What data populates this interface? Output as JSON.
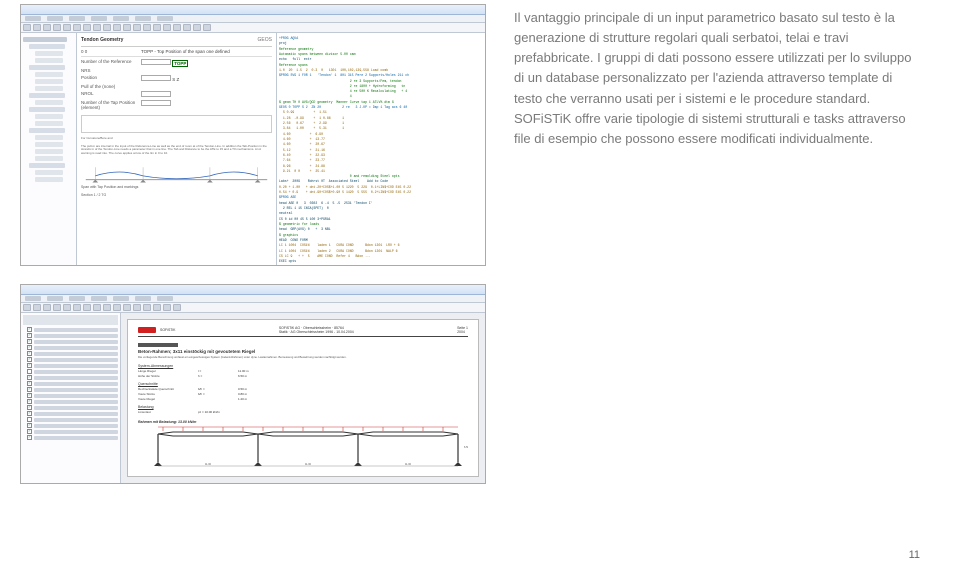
{
  "page_number": "11",
  "description": {
    "paragraph": "Il vantaggio principale di un input parametrico basato sul testo è la generazione di strutture regolari quali serbatoi, telai e travi prefabbricate. I gruppi di dati possono essere utilizzati per lo sviluppo di un database personalizzato per l'azienda attraverso template di testo che verranno usati per i sistemi e le procedure standard. SOFiSTiK offre varie tipologie di sistemi strutturali e tasks attraverso file di esempio che possono essere modificati individualmente."
  },
  "screenshot_a": {
    "panel_title": "Tendon Geometry",
    "panel_code": "GEOS",
    "field_code_label": "0 0",
    "field_code_desc": "TOPP - Top Position of the span one defined",
    "subfield1": "Number of the Reference",
    "subfield2": "NRS",
    "position_label": "Position",
    "pull_label": "Pull of the (none)",
    "roll_label": "NROL",
    "tap_label": "Number of the Tap Position (element)",
    "footer_left": "For Curvature/Bore and",
    "option_s": "S",
    "option_z": "Z",
    "option_topp": "TOPP",
    "beam_label": "Span with Tap Position and markings",
    "section_label": "Section 1 / 2 TG",
    "code": {
      "l1": "+PROG AQUA",
      "l2": "proj",
      "l3": "Reference geometry",
      "l4": "Automatic spans between divisor 5.00 cam",
      "l5": "echo   full  extr",
      "l6": "Reference spans",
      "l7": "1.0  20  1.5  2  0.3  0   1301  100,102,139,558 Load comb",
      "l8": "",
      "l9": "$PROG SVG 1 FOR 1   'Tendon' 1  801 315 Pere 2 Supports/Holes 211 ch",
      "l10": "                                     2 re 3 Supports/Fem, tendon",
      "l11": "                                     2 re 1800 + Hydroforming   tn",
      "l12": "                                     4 re 500 K Recalculating   + 4 ",
      "l13": "                                     4",
      "l14": "",
      "l15": "$ geom TH 0 AVG/QCD geometry  Manner Curve tap 1 ATLV% dtm G",
      "l16": "GEOS 0 TOPP S 2  ZN 20           2 re   3 J.OP = Dap 1 Tag acs 6 40",
      "l17": "  S 0.99          +  1.51",
      "l18": "  1.28  -0.99     +  1 0.86      1",
      "l19": "  2.56   0.67     +  2.99        1",
      "l20": "  3.84   1.00     +  5.31        1",
      "l21": "  4.60          +  6.90",
      "l22": "  4.60          +  13.77",
      "l23": "  4.60          +  20.67",
      "l24": "  5.12          +  21.16",
      "l25": "  6.40          +  22.93",
      "l26": "  7.64          +  23.77",
      "l27": "  8.96          +  24.88",
      "l28": "  9.21  0 0     +  25.41",
      "l29": "                                     0 and remolding Steel opts",
      "l30": "Labs+  2009    Rohrst 0T  Associated Steel    Add to Code",
      "l31": "0.20 + 1.00   + dnt.20+COS$+1.00 5 1220  5 229  0.1+LIN$+COD E45 0.22",
      "l32": "0.54 + 0.9    + dnt.90+COS$+0.90 5 1420  5 555  0.2+LIN$+COD E45 0.22",
      "l33": "",
      "l34": "$PROG ASE",
      "l35": "head ASE 0   3  0302  6 -4  5 -5  2531 'Tendon I'",
      "l36": "  2 REL 1 15 CNCA(SPET)  0",
      "l37": "neutral",
      "l38": "CS 0 id 00 45 5 100 3+PGRA1",
      "l39": "",
      "l40": "$ geometric for loads",
      "l41": "head  GRP(AVG) 0   +  3 NBL",
      "l42": "$ graphics",
      "l43": "HEAD  COND FORM",
      "l44": "LC 1 1004  COS1%    laden 1   CURA COND      Bdon 1301  LRO + 6",
      "l45": "LC 1 1004  COS1%    laden 2   CURA COND      Bdon 1301  NALP 6",
      "l46": "CS LC 9   + +  5    AME COND  Refer 4   Bdon ...",
      "l47": "EXEC opts"
    }
  },
  "screenshot_b": {
    "tree_items": [
      "Geometrie",
      "Lasten",
      "Material",
      "Querschnitt",
      "System",
      "Lastfaelle",
      "Bemessung"
    ],
    "report": {
      "brand": "SOFiSTiK",
      "doc_ref": "SOFiSTiK AG · Oberschleissheim · 85764",
      "doc_sub": "Statik · AG Oberschleissheim 1996 - 10.04.2004",
      "page": "Seite 1",
      "date": "2004",
      "section_title": "Beton-Rahmen; 3x11 einstöckig mit gevoutetem Riegel",
      "intro": "Die vorliegende Berechnung umfasst ein eingeschossiges System (Gelenk-Rahmen) unter dyne. Lastannahmen. Bemessung und Bewehrung werden nachfolgt werden.",
      "sec_dim": "System-Abmessungen",
      "dims": [
        {
          "label": "Länge Riegel",
          "value": "l =",
          "num": "11.00 m"
        },
        {
          "label": "Höhe der Stütze",
          "value": "h =",
          "num": "6.50 m"
        }
      ],
      "sec_q": "Querschnitte",
      "qdims": [
        {
          "label": "Rechtecksäule Querschnitt",
          "value": "b/h =",
          "num": "0.50 m"
        },
        {
          "label": "Voute Stütze",
          "value": "b/h =",
          "num": "0.80 m"
        },
        {
          "label": "Voute Riegel",
          "value": "",
          "num": "1.20 m"
        }
      ],
      "sec_load": "Belastung",
      "load_item": "Linienlast",
      "load_val": "pz = 10.00 kN/m",
      "frame_caption": "Rahmen mit Belastung: 13.00 kN/m"
    }
  }
}
